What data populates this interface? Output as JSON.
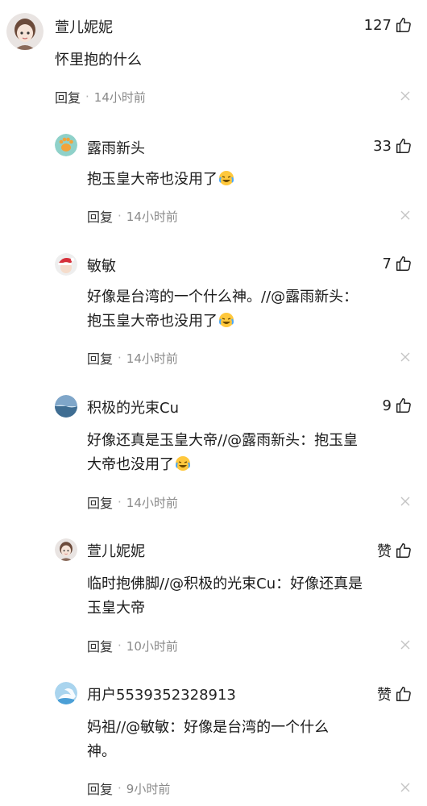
{
  "comments": [
    {
      "name": "萱儿妮妮",
      "likes": "127",
      "lines": [
        "怀里抱的什么"
      ],
      "reply": "回复",
      "time": "14小时前",
      "avatar": "girl-avatar",
      "emoji": false
    },
    {
      "name": "露雨新头",
      "likes": "33",
      "lines": [
        "抱玉皇大帝也没用了"
      ],
      "reply": "回复",
      "time": "14小时前",
      "avatar": "paw-avatar",
      "emoji": true
    },
    {
      "name": "敏敏",
      "likes": "7",
      "lines": [
        "好像是台湾的一个什么神。//@露雨新头：",
        "抱玉皇大帝也没用了"
      ],
      "reply": "回复",
      "time": "14小时前",
      "avatar": "santa-avatar",
      "emoji": true
    },
    {
      "name": "积极的光束Cu",
      "likes": "9",
      "lines": [
        "好像还真是玉皇大帝//@露雨新头：抱玉皇",
        "大帝也没用了"
      ],
      "reply": "回复",
      "time": "14小时前",
      "avatar": "landscape-avatar",
      "emoji": true
    },
    {
      "name": "萱儿妮妮",
      "likes": "赞",
      "lines": [
        "临时抱佛脚//@积极的光束Cu：好像还真是",
        "玉皇大帝"
      ],
      "reply": "回复",
      "time": "10小时前",
      "avatar": "girl-avatar",
      "emoji": false
    },
    {
      "name": "用户5539352328913",
      "likes": "赞",
      "lines": [
        "妈祖//@敏敏：好像是台湾的一个什么",
        "神。"
      ],
      "reply": "回复",
      "time": "9小时前",
      "avatar": "default-user-avatar",
      "emoji": false
    }
  ],
  "separator": "·",
  "colors": {
    "text": "#1a1a1a",
    "meta": "#8a8a8a",
    "close": "#c4c4c4"
  }
}
